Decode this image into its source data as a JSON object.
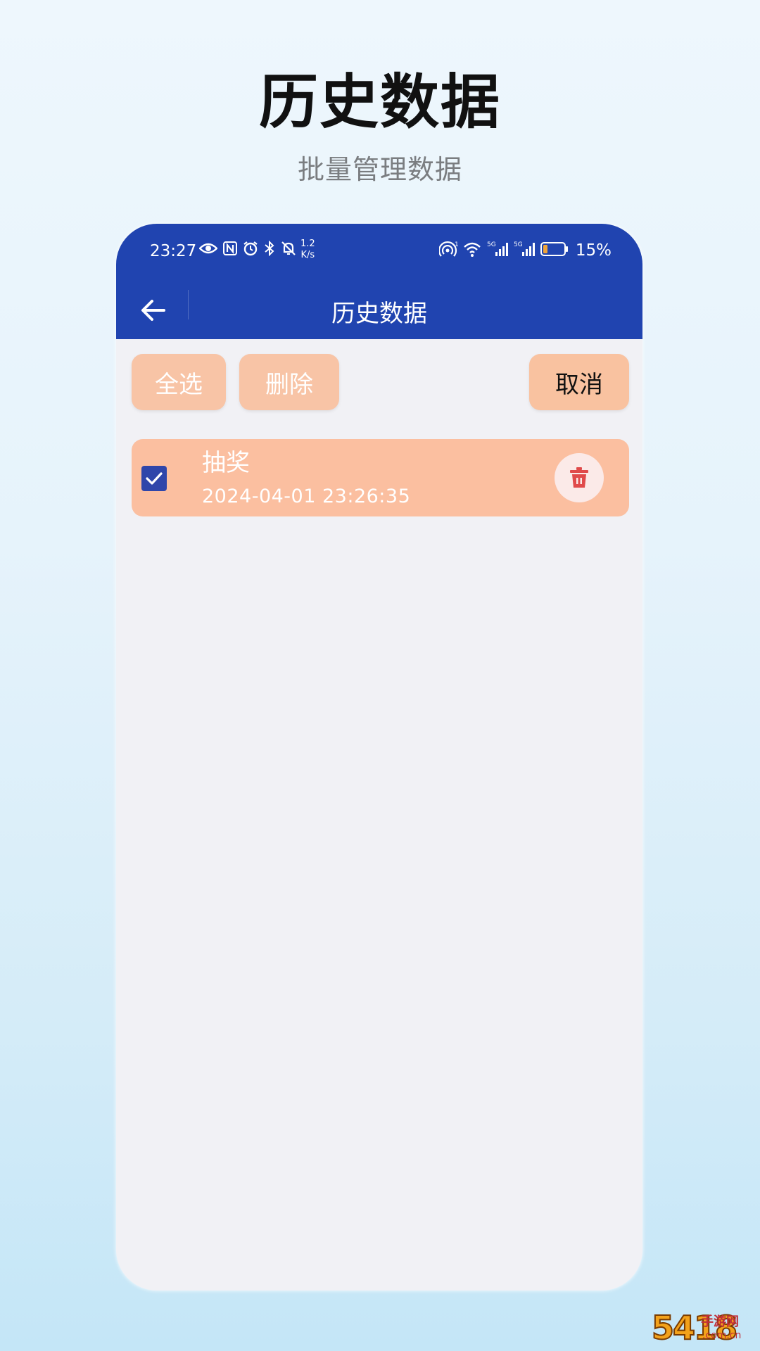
{
  "promo": {
    "title": "历史数据",
    "subtitle": "批量管理数据"
  },
  "status_bar": {
    "time": "23:27",
    "net_speed_value": "1.2",
    "net_speed_unit": "K/s",
    "battery": "15%"
  },
  "toolbar": {
    "title": "历史数据"
  },
  "actions": {
    "select_all": "全选",
    "delete": "删除",
    "cancel": "取消"
  },
  "records": [
    {
      "title": "抽奖",
      "time": "2024-04-01 23:26:35",
      "checked": true
    }
  ],
  "watermark": {
    "number": "5418",
    "text": "手游网",
    "domain": ".com.cn"
  },
  "colors": {
    "header": "#2044b0",
    "button": "#f8c4a6",
    "record_bg": "#fbbfa0",
    "checkbox": "#2f46aa",
    "delete_icon": "#e04a4a"
  }
}
